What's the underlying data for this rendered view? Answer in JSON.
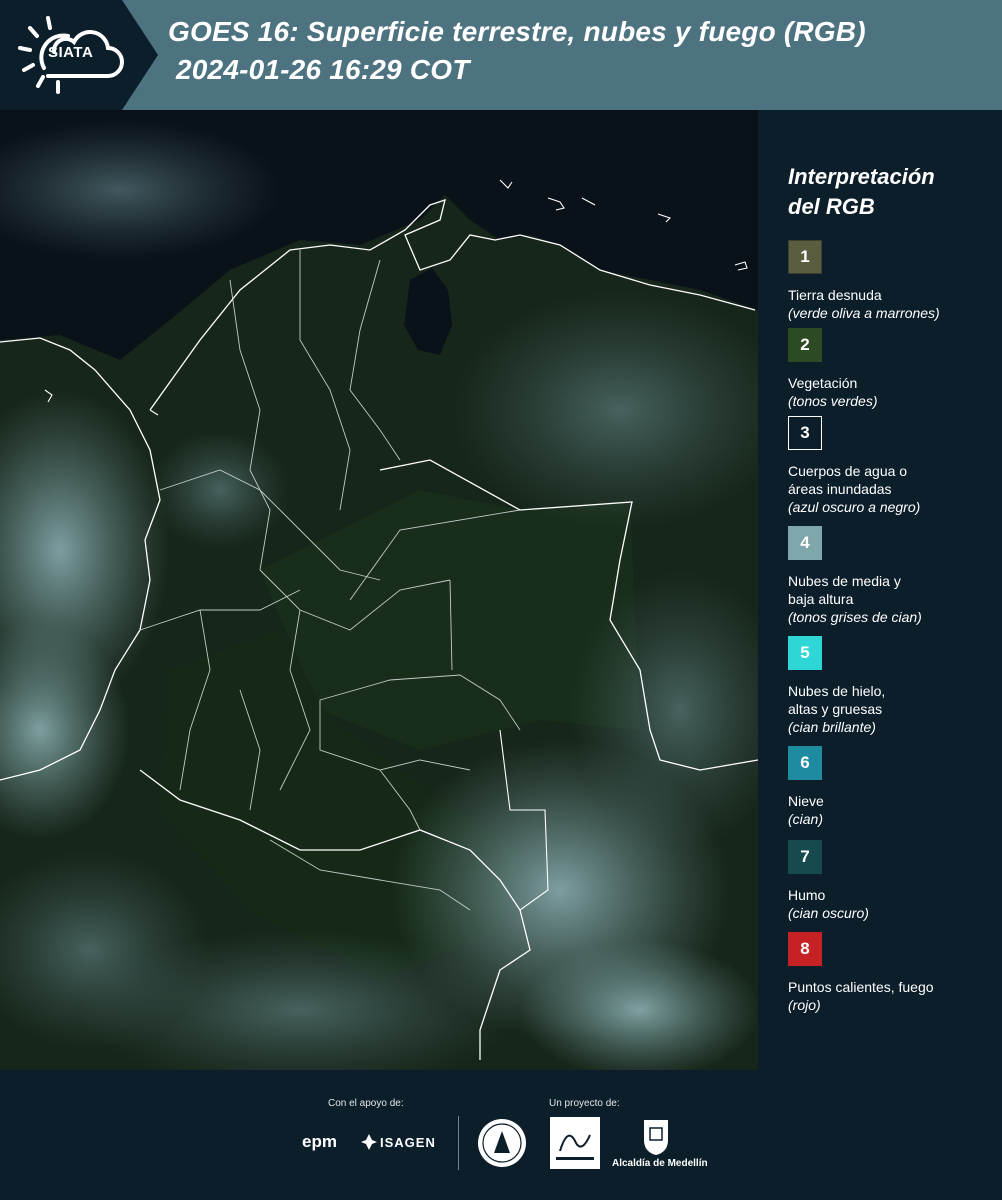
{
  "header": {
    "logo_text": "SIATA",
    "title_line1": "GOES 16: Superficie terrestre, nubes y fuego (RGB)",
    "title_line2": "2024-01-26 16:29 COT"
  },
  "legend": {
    "title_line1": "Interpretación",
    "title_line2": "del RGB",
    "items": [
      {
        "num": "1",
        "label": "Tierra desnuda",
        "label2": "",
        "sub": "(verde oliva a marrones)",
        "color": "#5b5c40"
      },
      {
        "num": "2",
        "label": "Vegetación",
        "label2": "",
        "sub": "(tonos verdes)",
        "color": "#2c4a24"
      },
      {
        "num": "3",
        "label": "Cuerpos de agua o",
        "label2": "áreas inundadas",
        "sub": "(azul oscuro a negro)",
        "color": "#0c1e2a"
      },
      {
        "num": "4",
        "label": "Nubes de media y",
        "label2": "baja altura",
        "sub": "(tonos grises de cian)",
        "color": "#7fa7ab"
      },
      {
        "num": "5",
        "label": "Nubes de hielo,",
        "label2": "altas y gruesas",
        "sub": "(cian brillante)",
        "color": "#2fd6d6"
      },
      {
        "num": "6",
        "label": "Nieve",
        "label2": "",
        "sub": "(cian)",
        "color": "#1e8ba1"
      },
      {
        "num": "7",
        "label": "Humo",
        "label2": "",
        "sub": "(cian oscuro)",
        "color": "#174a4e"
      },
      {
        "num": "8",
        "label": "Puntos calientes, fuego",
        "label2": "",
        "sub": "(rojo)",
        "color": "#c62226"
      }
    ]
  },
  "footer": {
    "support_label": "Con el apoyo de:",
    "project_label": "Un proyecto de:",
    "epm_text": "epm",
    "isagen_text": "ISAGEN",
    "alcaldia_text": "Alcaldía de Medellín"
  },
  "icons": [
    "sun-cloud-logo-icon",
    "isagen-logo-icon",
    "university-seal-icon",
    "area-metropolitana-logo-icon",
    "medellin-coat-of-arms-icon"
  ]
}
